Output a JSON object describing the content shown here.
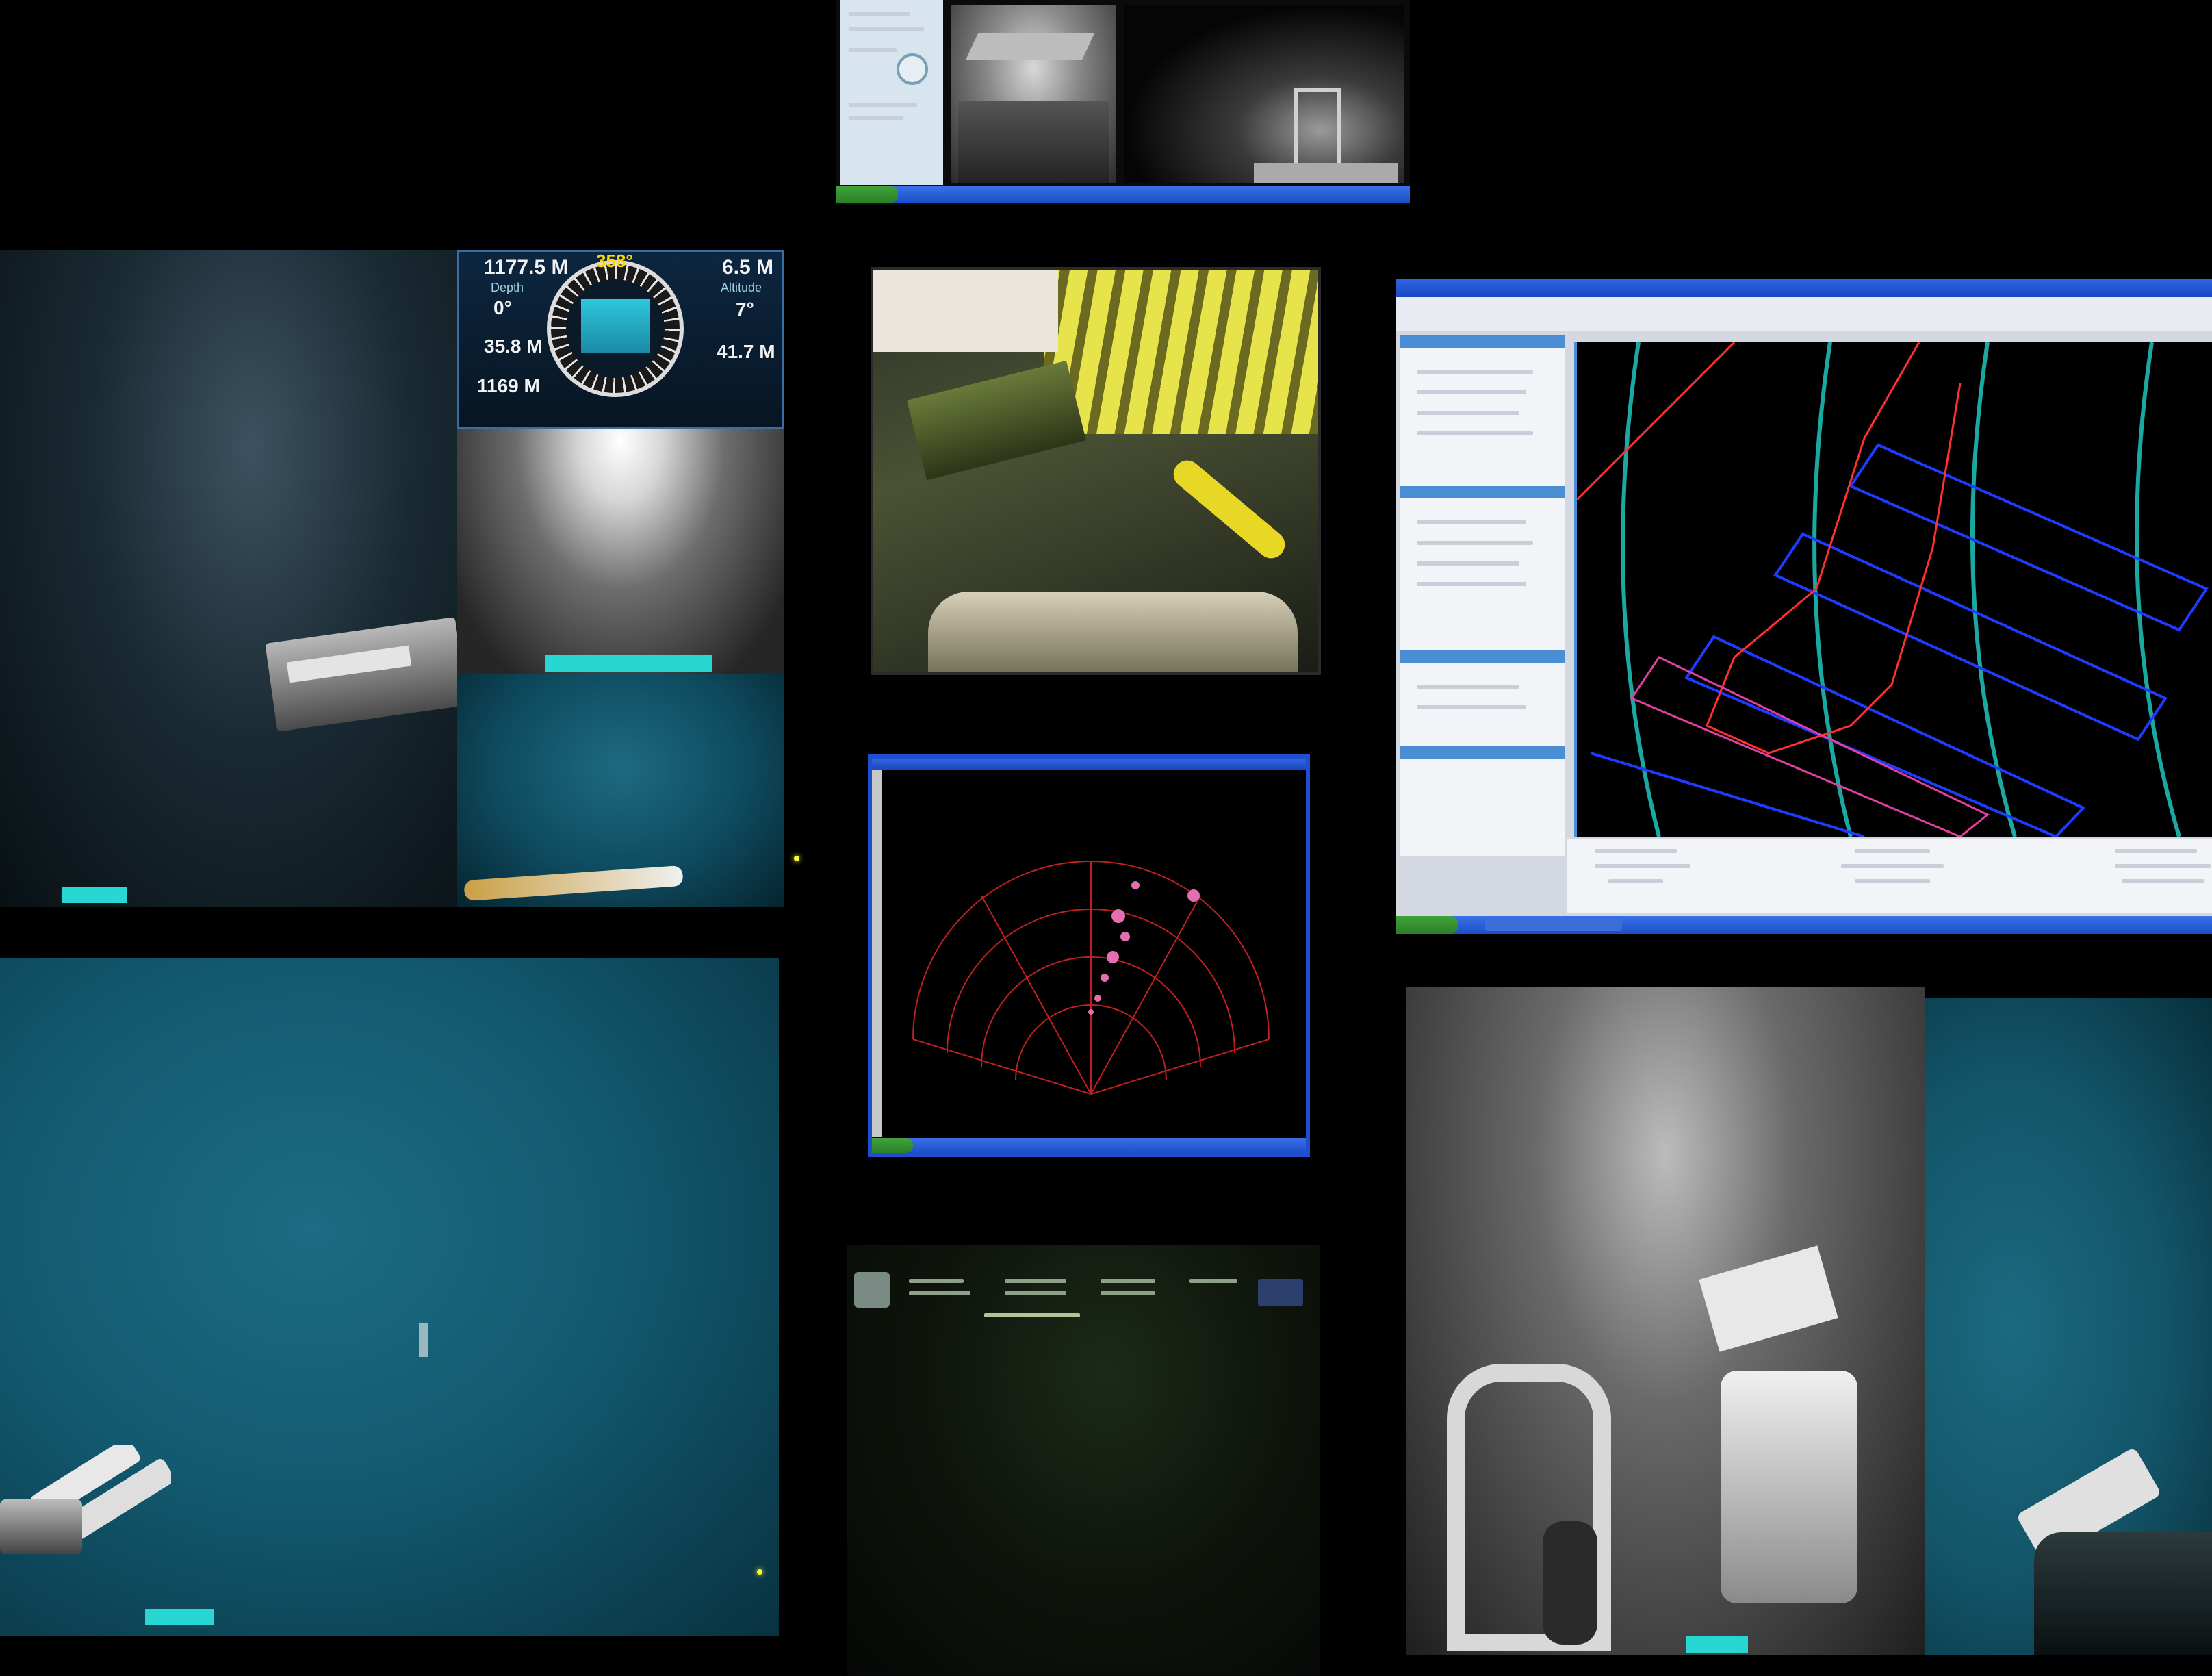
{
  "hud": {
    "heading": "358°",
    "depth": "1177.5 M",
    "altitude": "6.5 M",
    "pitch": "0°",
    "roll": "7°",
    "left_mid": "35.8 M",
    "right_mid": "41.7 M",
    "bottom_left": "1169 M",
    "depth_caption": "Depth",
    "altitude_caption": "Altitude"
  },
  "icons": {
    "compass": "compass-icon",
    "start": "windows-start-icon"
  },
  "colors": {
    "ocean": "#14586c",
    "tag": "#28d6d2",
    "xp_blue": "#1b4fc8",
    "sonar_red": "#d22a2a",
    "plot_blue": "#1e3cff",
    "plot_cyan": "#1aa8a0"
  }
}
